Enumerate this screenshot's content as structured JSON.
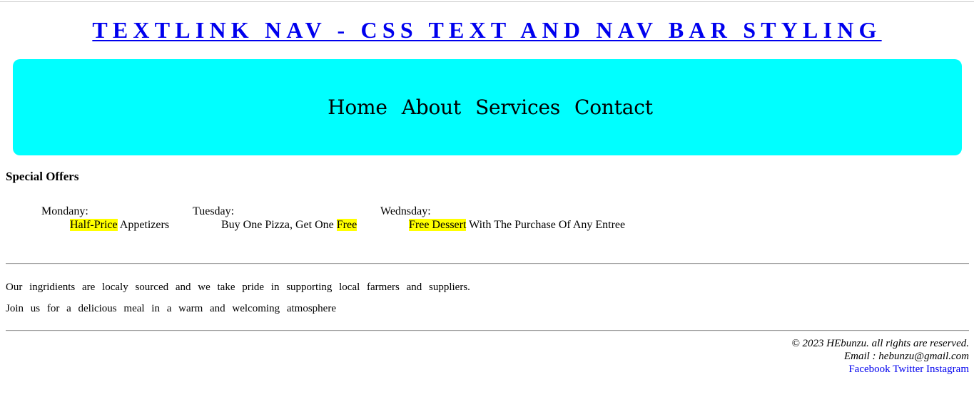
{
  "header": {
    "title": "TEXTLINK NAV - CSS TEXT AND NAV BAR STYLING"
  },
  "nav": {
    "items": [
      {
        "label": "Home"
      },
      {
        "label": "About"
      },
      {
        "label": "Services"
      },
      {
        "label": "Contact"
      }
    ]
  },
  "offers": {
    "heading": "Special Offers",
    "days": [
      {
        "day": "Mondany:",
        "highlight": "Half-Price",
        "rest": " Appetizers",
        "pre": ""
      },
      {
        "day": "Tuesday:",
        "pre": "Buy One Pizza, Get One ",
        "highlight": "Free",
        "rest": ""
      },
      {
        "day": "Wednsday:",
        "pre": "",
        "highlight": "Free Dessert",
        "rest": " With The Purchase Of Any Entree"
      }
    ],
    "highlight_color": "#ffff00"
  },
  "about": {
    "line1": "Our ingridients are localy sourced and we take pride in supporting local farmers and suppliers.",
    "line2": "Join us for a delicious meal in a warm and welcoming atmosphere"
  },
  "footer": {
    "copyright": "© 2023 HEbunzu. all rights are reserved.",
    "email": "Email : hebunzu@gmail.com",
    "social": [
      {
        "label": "Facebook"
      },
      {
        "label": "Twitter"
      },
      {
        "label": "Instagram"
      }
    ]
  },
  "colors": {
    "nav_background": "#00ffff",
    "link": "#0000ee"
  }
}
